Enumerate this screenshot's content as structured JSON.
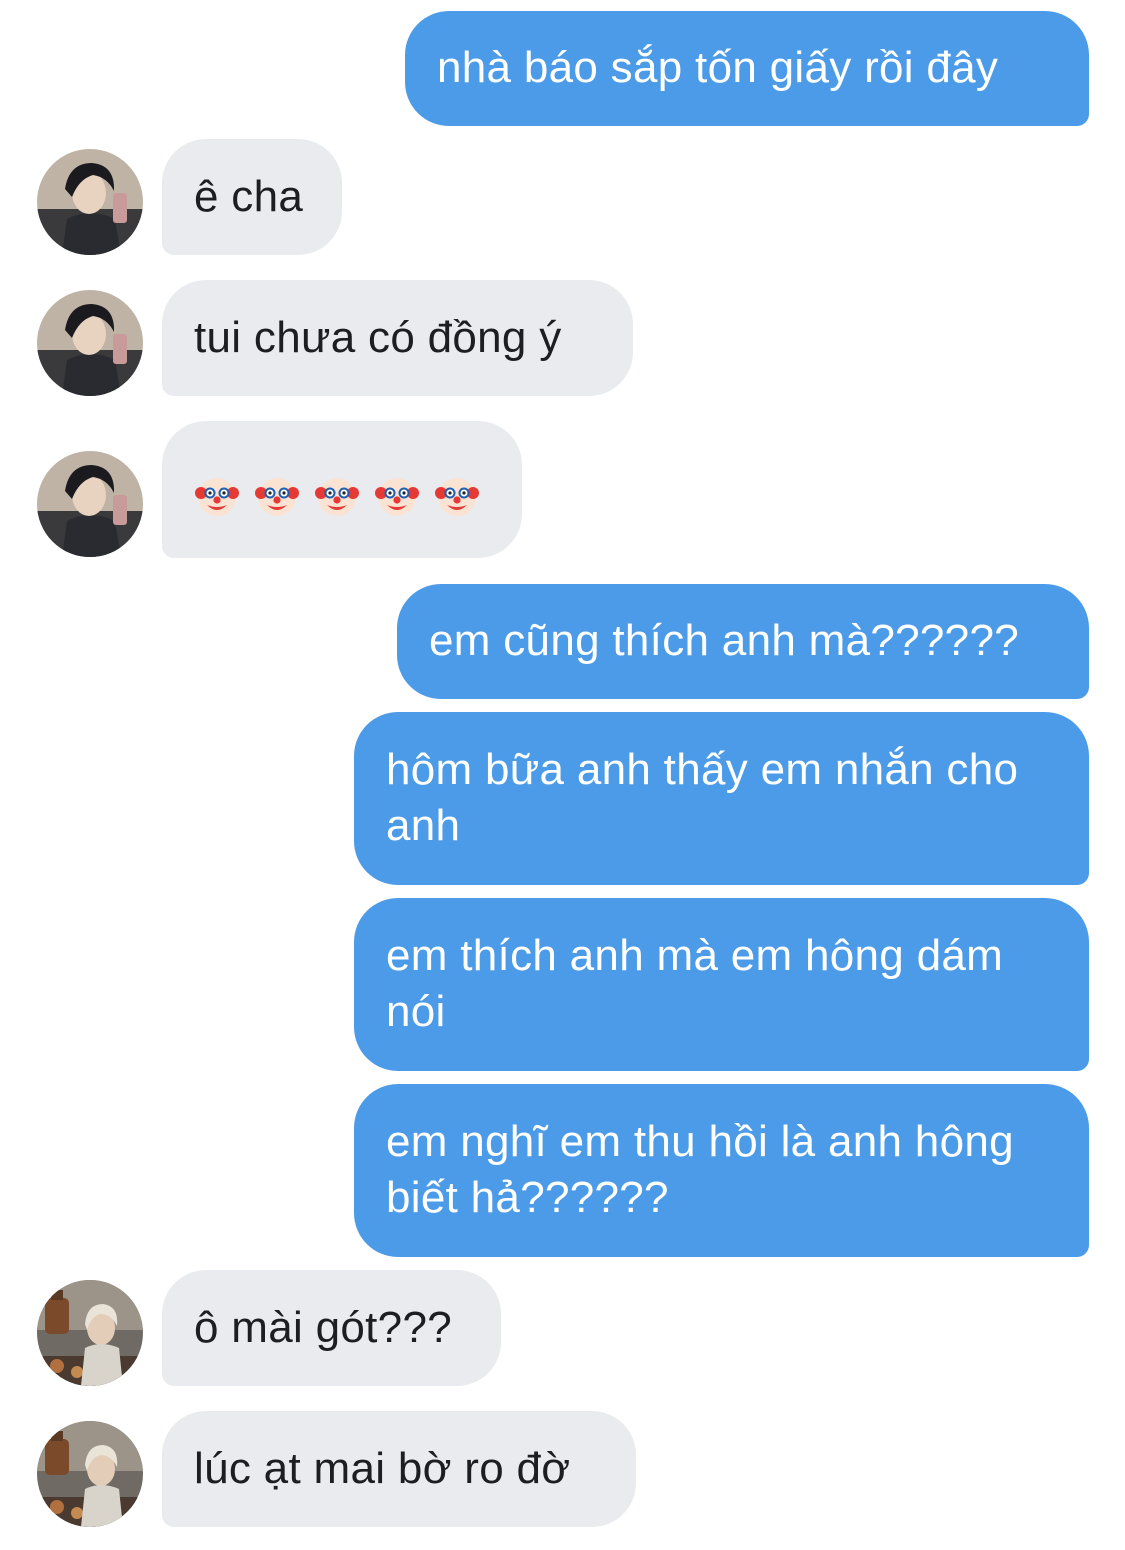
{
  "messages": [
    {
      "side": "out",
      "text": "nhà báo sắp tốn giấy rồi đây"
    },
    {
      "side": "in",
      "sender": "user-a",
      "text": "ê cha"
    },
    {
      "side": "in",
      "sender": "user-a",
      "text": "tui chưa có đồng ý"
    },
    {
      "side": "in",
      "sender": "user-a",
      "emoji": [
        "clown-face-icon",
        "clown-face-icon",
        "clown-face-icon",
        "clown-face-icon",
        "clown-face-icon"
      ]
    },
    {
      "side": "out",
      "text": "em cũng thích anh mà??????"
    },
    {
      "side": "out",
      "text": "hôm bữa anh thấy em nhắn cho anh"
    },
    {
      "side": "out",
      "text": "em thích anh mà em hông dám nói"
    },
    {
      "side": "out",
      "text": "em nghĩ em thu hồi là anh hông biết hả??????"
    },
    {
      "side": "in",
      "sender": "user-b",
      "text": "ô mài gót???"
    },
    {
      "side": "in",
      "sender": "user-b",
      "text": "lúc ạt mai bờ ro đờ"
    }
  ],
  "colors": {
    "outgoing_bubble": "#4c9be8",
    "incoming_bubble": "#e9ebee",
    "outgoing_text": "#ffffff",
    "incoming_text": "#1c1e21"
  }
}
